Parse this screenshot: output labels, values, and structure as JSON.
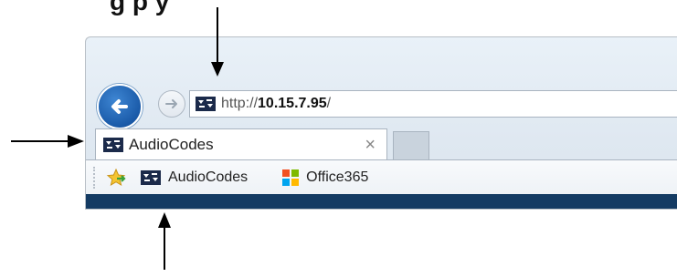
{
  "heading": "g                              p y",
  "address_bar": {
    "url_prefix": "http://",
    "url_host": "10.15.7.95",
    "url_suffix": "/"
  },
  "tab": {
    "title": "AudioCodes",
    "close_symbol": "×"
  },
  "favorites_bar": {
    "items": [
      {
        "label": "AudioCodes",
        "icon": "audiocodes-favicon"
      },
      {
        "label": "Office365",
        "icon": "office365-icon"
      }
    ]
  },
  "colors": {
    "accent": "#1a5aa8",
    "frame": "#dfe8f1",
    "dark_strip": "#143b63"
  }
}
